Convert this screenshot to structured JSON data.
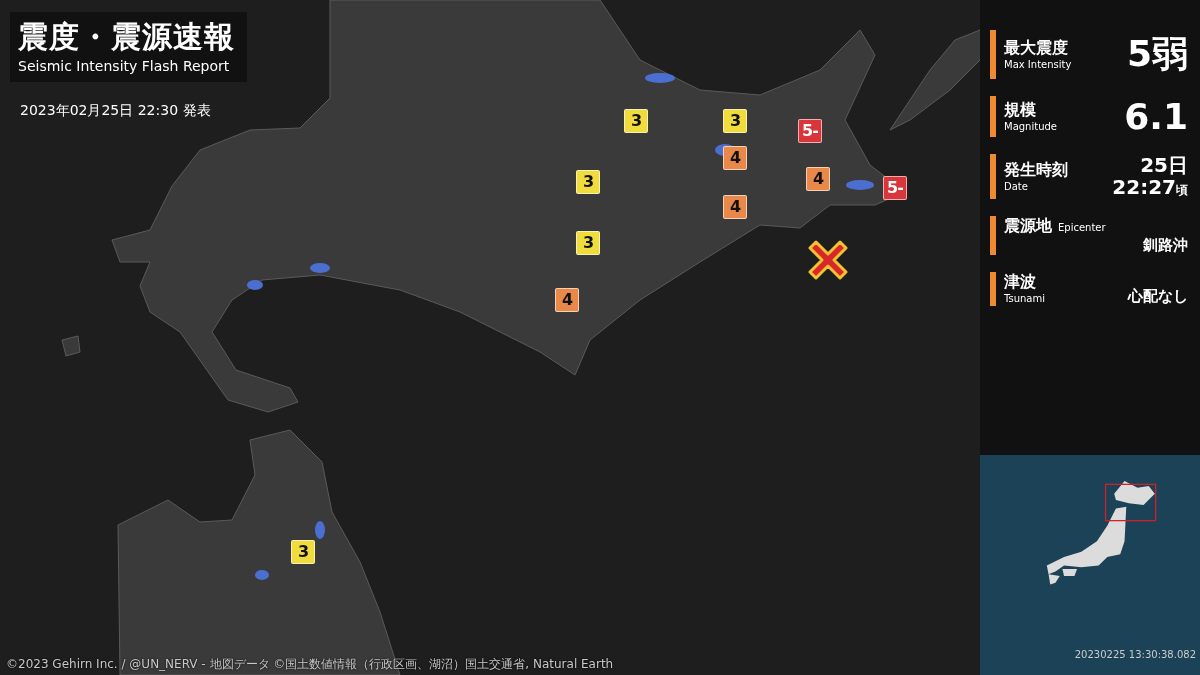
{
  "header": {
    "title": "震度・震源速報",
    "subtitle": "Seismic Intensity Flash Report",
    "issued": "2023年02月25日 22:30 発表"
  },
  "info": [
    {
      "kind": "big",
      "label": "最大震度",
      "label_en": "Max Intensity",
      "value": "5弱"
    },
    {
      "kind": "big",
      "label": "規模",
      "label_en": "Magnitude",
      "value": "6.1"
    },
    {
      "kind": "date",
      "label": "発生時刻",
      "label_en": "Date",
      "value": "25日",
      "time": "22:27",
      "suffix": "頃"
    },
    {
      "kind": "inline",
      "label": "震源地",
      "label_en": "Epicenter",
      "value": "釧路沖"
    },
    {
      "kind": "small",
      "label": "津波",
      "label_en": "Tsunami",
      "value": "心配なし"
    }
  ],
  "observations": [
    {
      "intensity": "3",
      "color": "#f0dc3c"
    },
    {
      "intensity": "3",
      "color": "#f0dc3c"
    },
    {
      "intensity": "5-",
      "color": "#d8363a"
    },
    {
      "intensity": "4",
      "color": "#e8894a"
    },
    {
      "intensity": "3",
      "color": "#f0dc3c"
    },
    {
      "intensity": "4",
      "color": "#e8894a"
    },
    {
      "intensity": "4",
      "color": "#e8894a"
    },
    {
      "intensity": "5-",
      "color": "#d8363a"
    },
    {
      "intensity": "3",
      "color": "#f0dc3c"
    },
    {
      "intensity": "4",
      "color": "#e8894a"
    },
    {
      "intensity": "3",
      "color": "#f0dc3c"
    }
  ],
  "credit": "©2023 Gehirn Inc. / @UN_NERV - 地図データ ©国土数値情報（行政区画、湖沼）国土交通省, Natural Earth",
  "timestamp": "20230225 13:30:38.082"
}
